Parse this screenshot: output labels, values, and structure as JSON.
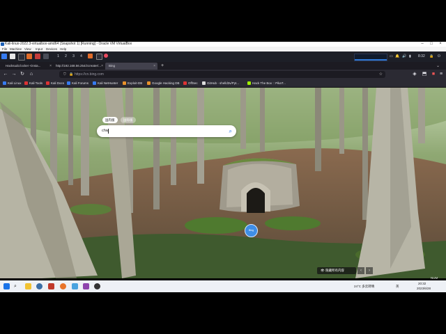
{
  "vbox": {
    "title": "Kali-linux-2022.3-virtualbox-amd64 (Snapshot 1) [Running] - Oracle VM VirtualBox",
    "menu": [
      "File",
      "Machine",
      "View",
      "Input",
      "Devices",
      "Help"
    ]
  },
  "kali_panel": {
    "workspaces": [
      "1",
      "2",
      "3",
      "4"
    ],
    "clock": "8:32"
  },
  "browser": {
    "tabs": [
      {
        "label": "Hacksudo:locker <insta..."
      },
      {
        "label": "http://192.168.56.254/zcreater/..."
      },
      {
        "label": "Bing"
      }
    ],
    "url": "https://cn.bing.com",
    "bookmarks": [
      "Kali Linux",
      "Kali Tools",
      "Kali Docs",
      "Kali Forums",
      "Kali NetHunter",
      "Exploit-DB",
      "Google Hacking DB",
      "OffSec",
      "GitHub - shelld3v/Pyt...",
      "Hack The Box :: PikaT..."
    ]
  },
  "bing": {
    "scope_cn": "国内版",
    "scope_intl": "国际版",
    "query": "chw",
    "hide_label": "隐藏所有内容",
    "circle_label": "Bing"
  },
  "taskbar": {
    "weather": "24°C 多云转晴",
    "time": "20:32",
    "date": "2023/6/28",
    "tray_label": "NUM",
    "lang_label": "英"
  },
  "colors": {
    "kali_panel": "#1d1f27",
    "tab_active": "#42414d",
    "accent": "#3f8ee6"
  }
}
